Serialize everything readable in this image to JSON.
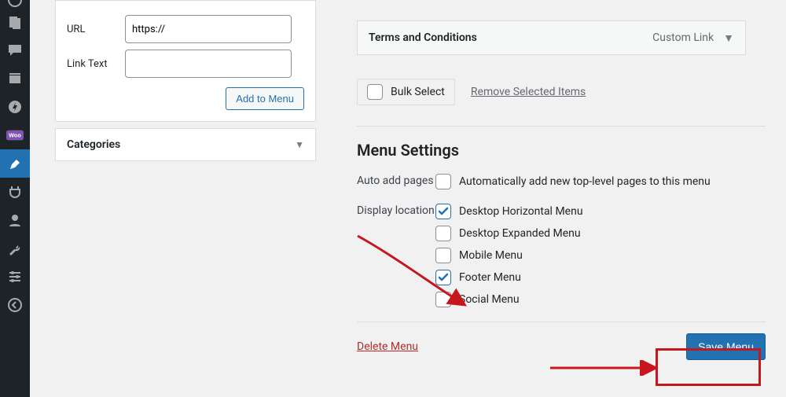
{
  "custom_links": {
    "url_label": "URL",
    "url_value": "https://",
    "link_text_label": "Link Text",
    "link_text_value": "",
    "add_to_menu_label": "Add to Menu"
  },
  "categories_panel": {
    "title": "Categories"
  },
  "menu_item": {
    "title": "Terms and Conditions",
    "type": "Custom Link"
  },
  "bulk": {
    "select_label": "Bulk Select",
    "remove_label": "Remove Selected Items"
  },
  "menu_settings": {
    "heading": "Menu Settings",
    "auto_add_label": "Auto add pages",
    "auto_add_option": "Automatically add new top-level pages to this menu",
    "auto_add_checked": false,
    "display_location_label": "Display location",
    "locations": [
      {
        "label": "Desktop Horizontal Menu",
        "checked": true
      },
      {
        "label": "Desktop Expanded Menu",
        "checked": false
      },
      {
        "label": "Mobile Menu",
        "checked": false
      },
      {
        "label": "Footer Menu",
        "checked": true
      },
      {
        "label": "Social Menu",
        "checked": false
      }
    ]
  },
  "footer": {
    "delete_label": "Delete Menu",
    "save_label": "Save Menu"
  },
  "sidebar_icons": [
    "posts-icon",
    "media-icon",
    "comments-icon",
    "pages-icon",
    "amp-icon",
    "woocommerce-icon",
    "appearance-icon",
    "plugins-icon",
    "users-icon",
    "tools-icon",
    "settings-icon",
    "collapse-icon"
  ]
}
